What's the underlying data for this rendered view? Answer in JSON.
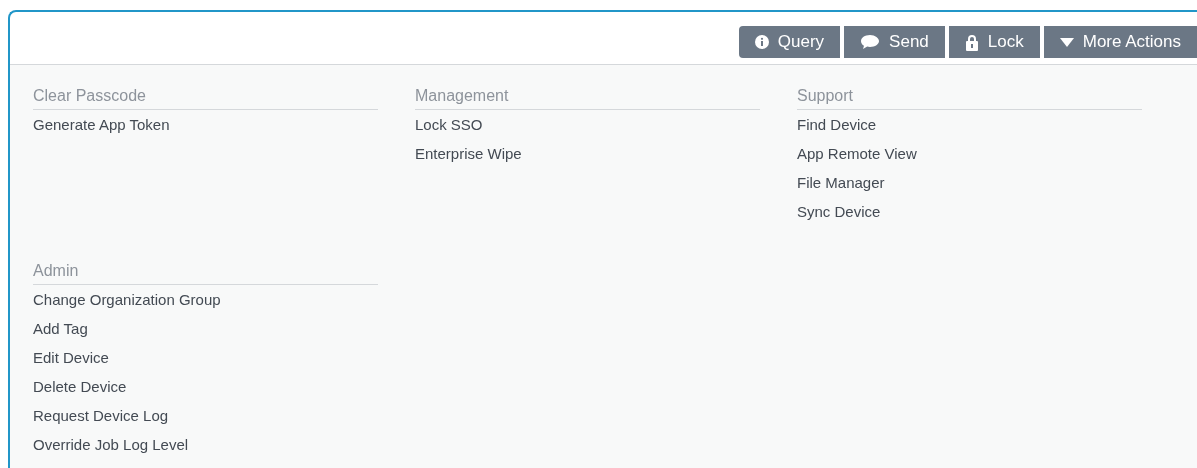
{
  "toolbar": [
    {
      "kind": "info",
      "label": "Query"
    },
    {
      "kind": "chat",
      "label": "Send"
    },
    {
      "kind": "lock",
      "label": "Lock"
    },
    {
      "kind": "caret",
      "label": "More Actions"
    }
  ],
  "menu_groups": [
    {
      "heading": "Clear Passcode",
      "items": [
        "Generate App Token"
      ]
    },
    {
      "heading": "Management",
      "items": [
        "Lock SSO",
        "Enterprise Wipe"
      ]
    },
    {
      "heading": "Support",
      "items": [
        "Find Device",
        "App Remote View",
        "File Manager",
        "Sync Device"
      ]
    },
    {
      "heading": "Admin",
      "items": [
        "Change Organization Group",
        "Add Tag",
        "Edit Device",
        "Delete Device",
        "Request Device Log",
        "Override Job Log Level"
      ]
    }
  ]
}
